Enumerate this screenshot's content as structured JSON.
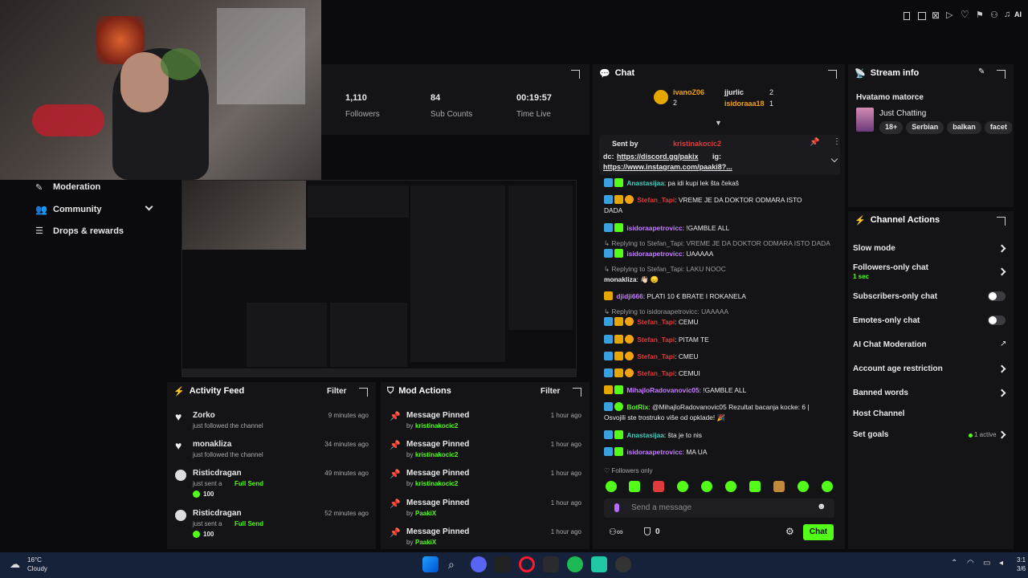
{
  "stats": [
    {
      "value": "1,110",
      "label": "Followers"
    },
    {
      "value": "84",
      "label": "Sub Counts"
    },
    {
      "value": "00:19:57",
      "label": "Time Live"
    }
  ],
  "sidebar": {
    "items": [
      {
        "label": "Moderation"
      },
      {
        "label": "Community"
      },
      {
        "label": "Drops & rewards"
      }
    ]
  },
  "chat": {
    "title": "Chat",
    "top_chatters": [
      {
        "name": "ivanoZ06",
        "count": "2"
      },
      {
        "name": "jjurlic",
        "count": "2"
      },
      {
        "name": "isidoraaa18",
        "count": "1"
      }
    ],
    "pinned": {
      "sent_by_label": "Sent by",
      "sender": "kristinakocic2",
      "dc_label": "dc:",
      "discord": "https://discord.gg/pakix",
      "ig_label": "ig:",
      "instagram": "https://www.instagram.com/paaki8?..."
    },
    "messages": [
      {
        "user": "Anastasijaa",
        "text": "pa idi kupi lek šta čekaš"
      },
      {
        "user": "Stefan_Tapi",
        "text": "VREME JE DA DOKTOR ODMARA ISTO"
      },
      {
        "user": "",
        "text": "DADA"
      },
      {
        "user": "isidoraapetrovicc",
        "text": "!GAMBLE ALL"
      },
      {
        "reply": "Replying to Stefan_Tapi: VREME JE DA DOKTOR ODMARA ISTO DADA"
      },
      {
        "user": "isidoraapetrovicc",
        "text": "UAAAAA"
      },
      {
        "reply": "Replying to Stefan_Tapi: LAKU NOOC"
      },
      {
        "user": "monakliza",
        "text": "👋🏻 😞"
      },
      {
        "user": "djidji666",
        "text": "PLATI 10 € BRATE I ROKANELA"
      },
      {
        "reply": "Replying to isidoraapetrovicc: UAAAAA"
      },
      {
        "user": "Stefan_Tapi",
        "text": "CEMU"
      },
      {
        "user": "Stefan_Tapi",
        "text": "PITAM TE"
      },
      {
        "user": "Stefan_Tapi",
        "text": "CMEU"
      },
      {
        "user": "Stefan_Tapi",
        "text": "CEMUI"
      },
      {
        "user": "MihajloRadovanovic05",
        "text": "!GAMBLE ALL"
      },
      {
        "user": "BotRix",
        "text": "@MihajloRadovanovic05 Rezultat bacanja kocke: 6 |"
      },
      {
        "user": "",
        "text": "Osvojili ste trostruko više od opklade! 🎉"
      },
      {
        "user": "Anastasijaa",
        "text": "šta je to nis"
      },
      {
        "user": "isidoraapetrovicc",
        "text": "MA UA"
      }
    ],
    "followers_only": "Followers only",
    "placeholder": "Send a message",
    "viewer_count": "0",
    "send_label": "Chat"
  },
  "stream_info": {
    "title": "Stream info",
    "stream_title": "Hvatamo matorce",
    "category": "Just Chatting",
    "tags": [
      "18+",
      "Serbian",
      "balkan",
      "facet"
    ]
  },
  "channel_actions": {
    "title": "Channel Actions",
    "items": [
      {
        "label": "Slow mode"
      },
      {
        "label": "Followers-only chat",
        "sub": "1 sec"
      },
      {
        "label": "Subscribers-only chat"
      },
      {
        "label": "Emotes-only chat"
      },
      {
        "label": "AI Chat Moderation"
      },
      {
        "label": "Account age restriction"
      },
      {
        "label": "Banned words"
      },
      {
        "label": "Host Channel"
      },
      {
        "label": "Set goals",
        "badge": "1 active"
      }
    ]
  },
  "activity_feed": {
    "title": "Activity Feed",
    "filter": "Filter",
    "items": [
      {
        "name": "Zorko",
        "action": "just followed the channel",
        "time": "9 minutes ago"
      },
      {
        "name": "monakliza",
        "action": "just followed the channel",
        "time": "34 minutes ago"
      },
      {
        "name": "Risticdragan",
        "action": "just sent a",
        "highlight": "Full Send",
        "amount": "100",
        "time": "49 minutes ago"
      },
      {
        "name": "Risticdragan",
        "action": "just sent a",
        "highlight": "Full Send",
        "amount": "100",
        "time": "52 minutes ago"
      }
    ]
  },
  "mod_actions": {
    "title": "Mod Actions",
    "filter": "Filter",
    "items": [
      {
        "title": "Message Pinned",
        "by": "by",
        "user": "kristinakocic2",
        "time": "1 hour ago"
      },
      {
        "title": "Message Pinned",
        "by": "by",
        "user": "kristinakocic2",
        "time": "1 hour ago"
      },
      {
        "title": "Message Pinned",
        "by": "by",
        "user": "kristinakocic2",
        "time": "1 hour ago"
      },
      {
        "title": "Message Pinned",
        "by": "by",
        "user": "PaakiX",
        "time": "1 hour ago"
      },
      {
        "title": "Message Pinned",
        "by": "by",
        "user": "PaakiX",
        "time": "1 hour ago"
      }
    ]
  },
  "taskbar": {
    "temperature": "16°C",
    "weather": "Cloudy",
    "clock_time": "3:1",
    "clock_date": "3/6"
  },
  "top_right": {
    "ai_label": "AI"
  },
  "colors": {
    "brand": "#53fc18",
    "panel": "#141417",
    "background": "#0b0b0d",
    "username_red": "#e03b3b",
    "username_purple": "#c77dff"
  }
}
